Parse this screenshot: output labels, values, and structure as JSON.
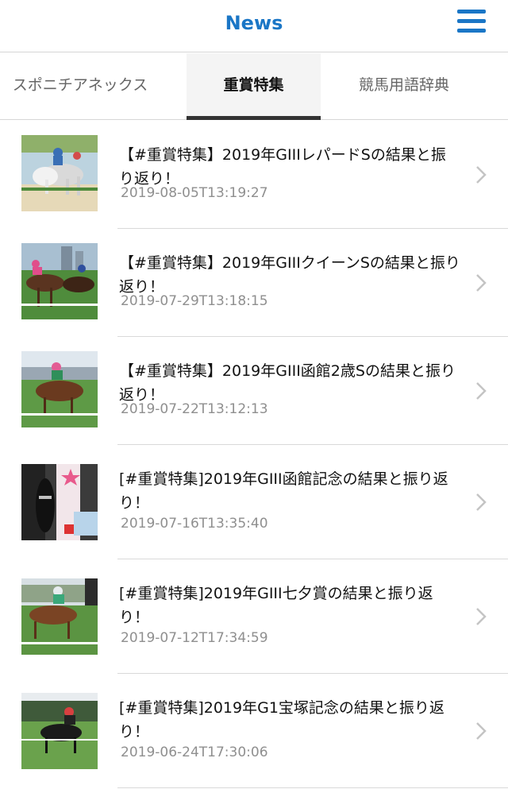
{
  "header": {
    "title": "News",
    "menu_icon": "hamburger-menu-icon"
  },
  "tabs": [
    {
      "label": "スポニチアネックス",
      "active": false
    },
    {
      "label": "重賞特集",
      "active": true
    },
    {
      "label": "競馬用語辞典",
      "active": false
    }
  ],
  "articles": [
    {
      "title": "【#重賞特集】2019年GIIIレパードSの結果と振り返り！",
      "date": "2019-08-05T13:19:27"
    },
    {
      "title": "【#重賞特集】2019年GIIIクイーンSの結果と振り返り！",
      "date": "2019-07-29T13:18:15"
    },
    {
      "title": "【#重賞特集】2019年GIII函館2歳Sの結果と振り返り！",
      "date": "2019-07-22T13:12:13"
    },
    {
      "title": "[#重賞特集]2019年GIII函館記念の結果と振り返り！",
      "date": "2019-07-16T13:35:40"
    },
    {
      "title": "[#重賞特集]2019年GIII七夕賞の結果と振り返り！",
      "date": "2019-07-12T17:34:59"
    },
    {
      "title": "[#重賞特集]2019年G1宝塚記念の結果と振り返り！",
      "date": "2019-06-24T17:30:06"
    }
  ],
  "colors": {
    "accent": "#1a76c6",
    "date": "#8f8f8f",
    "separator": "#d9d9d9"
  }
}
